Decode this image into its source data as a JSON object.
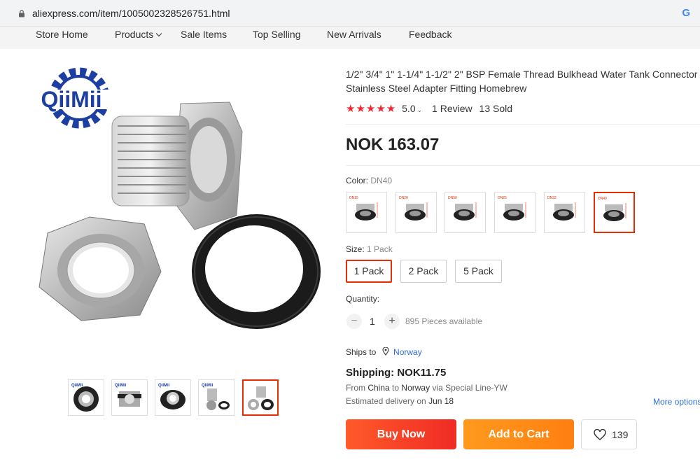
{
  "browser": {
    "url": "aliexpress.com/item/1005002328526751.html"
  },
  "nav": {
    "store_home": "Store Home",
    "products": "Products",
    "sale_items": "Sale Items",
    "top_selling": "Top Selling",
    "new_arrivals": "New Arrivals",
    "feedback": "Feedback"
  },
  "brand": {
    "logo_text": "QiiMii"
  },
  "product": {
    "title": "1/2\" 3/4\" 1\" 1-1/4\" 1-1/2\" 2\" BSP Female Thread Bulkhead Water Tank Connector Stainless Steel Adapter Fitting Homebrew",
    "stars": "★★★★★",
    "rating": "5.0",
    "reviews": "1 Review",
    "sold": "13 Sold",
    "price": "NOK 163.07"
  },
  "color": {
    "label": "Color:",
    "selected": "DN40",
    "options": [
      "DN15",
      "DN20",
      "DN50",
      "DN25",
      "DN32",
      "DN40"
    ],
    "selected_index": 5
  },
  "size": {
    "label": "Size:",
    "selected": "1 Pack",
    "options": [
      "1 Pack",
      "2 Pack",
      "5 Pack"
    ]
  },
  "quantity": {
    "label": "Quantity:",
    "value": "1",
    "minus": "−",
    "plus": "+",
    "available": "895 Pieces available"
  },
  "shipping": {
    "ships_to_label": "Ships to",
    "country": "Norway",
    "cost": "Shipping: NOK11.75",
    "from_prefix": "From",
    "from": "China",
    "to_prefix": "to",
    "to": "Norway",
    "via": "via Special Line-YW",
    "delivery_prefix": "Estimated delivery on",
    "delivery_date": "Jun 18",
    "more_options": "More options"
  },
  "actions": {
    "buy_now": "Buy Now",
    "add_to_cart": "Add to Cart",
    "wishlist_count": "139"
  },
  "colors": {
    "accent_red": "#e62e04",
    "buy_now": "#f02b24",
    "add_to_cart": "#ff8a16",
    "link_blue": "#2e6eda",
    "logo_blue": "#1d3fa2"
  }
}
